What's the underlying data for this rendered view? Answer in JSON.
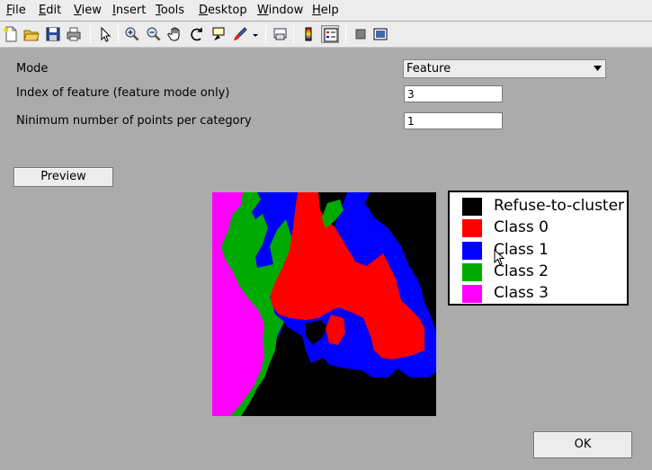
{
  "menubar": {
    "items": [
      {
        "mnemonic": "F",
        "rest": "ile"
      },
      {
        "mnemonic": "E",
        "rest": "dit"
      },
      {
        "mnemonic": "V",
        "rest": "iew"
      },
      {
        "mnemonic": "I",
        "rest": "nsert"
      },
      {
        "mnemonic": "T",
        "rest": "ools"
      },
      {
        "mnemonic": "D",
        "rest": "esktop"
      },
      {
        "mnemonic": "W",
        "rest": "indow"
      },
      {
        "mnemonic": "H",
        "rest": "elp"
      }
    ]
  },
  "toolbar": {
    "icons": [
      "new-figure-icon",
      "open-file-icon",
      "save-icon",
      "print-icon",
      "select-arrow-icon",
      "zoom-in-icon",
      "zoom-out-icon",
      "pan-hand-icon",
      "rotate-3d-icon",
      "data-cursor-icon",
      "brush-icon",
      "dropdown-arrow-icon",
      "link-plot-icon",
      "colorbar-icon",
      "legend-icon",
      "hide-plot-tools-icon",
      "show-plot-tools-icon"
    ],
    "pressed": "legend-icon"
  },
  "form": {
    "mode_label": "Mode",
    "mode_value": "Feature",
    "index_label": "Index of feature (feature mode only)",
    "index_value": "3",
    "min_points_label": "Ninimum number of points per category",
    "min_points_value": "1"
  },
  "buttons": {
    "preview": "Preview",
    "ok": "OK"
  },
  "legend": {
    "entries": [
      {
        "label": "Refuse-to-cluster",
        "color": "#000000"
      },
      {
        "label": "Class 0",
        "color": "#ff0000"
      },
      {
        "label": "Class 1",
        "color": "#0000ff"
      },
      {
        "label": "Class 2",
        "color": "#00aa00"
      },
      {
        "label": "Class 3",
        "color": "#ff00ff"
      }
    ]
  }
}
